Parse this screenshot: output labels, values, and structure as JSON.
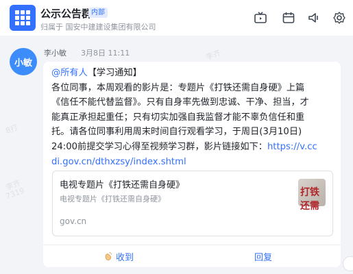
{
  "header": {
    "group_name": "公示公告群",
    "internal_tag": "内部",
    "org_line": "归属于 国安中建建设集团有限公司"
  },
  "message": {
    "avatar_text": "小敏",
    "sender": "李小敏",
    "time": "3月8日 11:11",
    "mention": "@所有人",
    "lines": [
      "【学习通知】",
      "各位同事，本周观看的影片是：专题片《打铁还需自身硬》上篇",
      "《信任不能代替监督》。只有自身率先做到忠诚、干净、担当，才",
      "能真正承担起重任；只有切实加强自我监督才能不辜负信任和重",
      "托。请各位同事利用周末时间自行观看学习，于周日(3月10日)",
      "24:00前提交学习心得至视频学习群，影片链接如下："
    ],
    "link_part1": "https://v.cc",
    "link_part2": "di.gov.cn/dthxzsy/index.shtml"
  },
  "card": {
    "title": "电视专题片《打铁还需自身硬》",
    "desc": "电视专题片《打铁还需自身硬》",
    "domain": "gov.cn",
    "thumb_text": "打铁还需"
  },
  "actions": {
    "received": "收到",
    "reply": "回复"
  },
  "watermark": {
    "text_a": "李齐",
    "text_b": "7319",
    "text_c": "8打"
  },
  "colors": {
    "accent": "#3370ff",
    "avatar": "#3c8dfb"
  }
}
